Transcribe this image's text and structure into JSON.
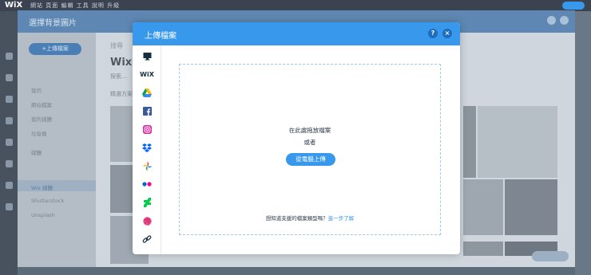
{
  "editor": {
    "logo": "WiX",
    "menu": "網站 頁面 編輯 工具 說明 升級"
  },
  "background_dialog": {
    "title": "選擇背景圖片",
    "upload_button": "+上傳檔案",
    "search_placeholder": "搜尋",
    "section_title": "Wix",
    "section_sub": "探索...",
    "section_sub2": "精選方案",
    "sidebar": {
      "group1": "我的",
      "items1": [
        "網站檔案",
        "我的媒體",
        "垃圾桶"
      ],
      "group2": "媒體",
      "items2": [
        "Wix 媒體",
        "Shutterstock",
        "Unsplash"
      ]
    }
  },
  "modal": {
    "title": "上傳檔案",
    "help_icon_label": "?",
    "close_icon_label": "×",
    "sources": [
      "computer",
      "wix",
      "google-drive",
      "facebook",
      "instagram",
      "dropbox",
      "google-photos",
      "flickr",
      "deviantart",
      "dribbble",
      "link"
    ],
    "wix_label": "WiX",
    "drop_text": "在此處拖放檔案",
    "or_text": "或者",
    "upload_button": "從電腦上傳",
    "help_text": "想知道支援的檔案類型嗎？",
    "help_link": "進一步了解"
  },
  "colors": {
    "accent": "#3899ec",
    "header": "#3899ec"
  }
}
